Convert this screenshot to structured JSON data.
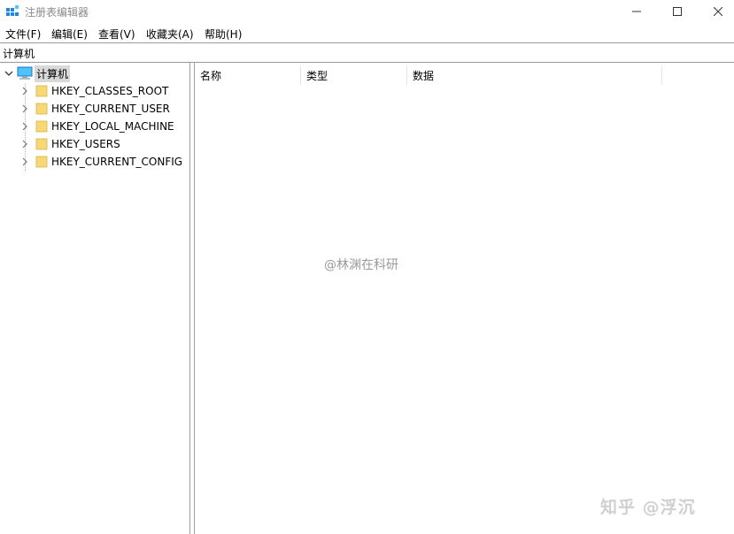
{
  "window": {
    "title": "注册表编辑器"
  },
  "menu": {
    "items": [
      "文件(F)",
      "编辑(E)",
      "查看(V)",
      "收藏夹(A)",
      "帮助(H)"
    ]
  },
  "address": {
    "path": "计算机"
  },
  "tree": {
    "root": "计算机",
    "children": [
      "HKEY_CLASSES_ROOT",
      "HKEY_CURRENT_USER",
      "HKEY_LOCAL_MACHINE",
      "HKEY_USERS",
      "HKEY_CURRENT_CONFIG"
    ]
  },
  "list": {
    "columns": [
      "名称",
      "类型",
      "数据"
    ]
  },
  "watermarks": {
    "center": "@林渊在科研",
    "corner": "知乎 @浮沉"
  },
  "colors": {
    "folder": "#f8d775",
    "selection": "#d9d9d9",
    "icon_blue": "#1e88e5"
  }
}
